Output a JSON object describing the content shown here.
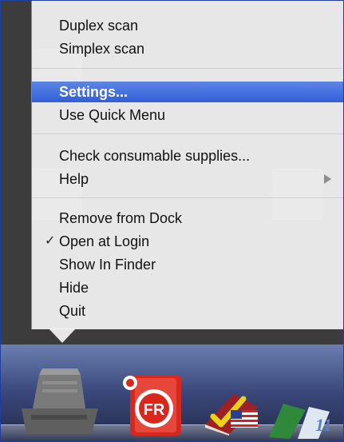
{
  "menu": {
    "items": [
      {
        "label": "Duplex scan"
      },
      {
        "label": "Simplex scan"
      },
      {
        "label": "Settings...",
        "selected": true
      },
      {
        "label": "Use Quick Menu"
      },
      {
        "label": "Check consumable supplies..."
      },
      {
        "label": "Help",
        "submenu": true
      },
      {
        "label": "Remove from Dock"
      },
      {
        "label": "Open at Login",
        "checked": true
      },
      {
        "label": "Show In Finder"
      },
      {
        "label": "Hide"
      },
      {
        "label": "Quit"
      }
    ],
    "checkmark_glyph": "✓",
    "selection_color": "#3a67dc"
  },
  "dock": {
    "icons": [
      "scanner-icon",
      "finereader-icon",
      "dictionary-book-icon",
      "us-flag-icon",
      "document-file-icon"
    ]
  }
}
